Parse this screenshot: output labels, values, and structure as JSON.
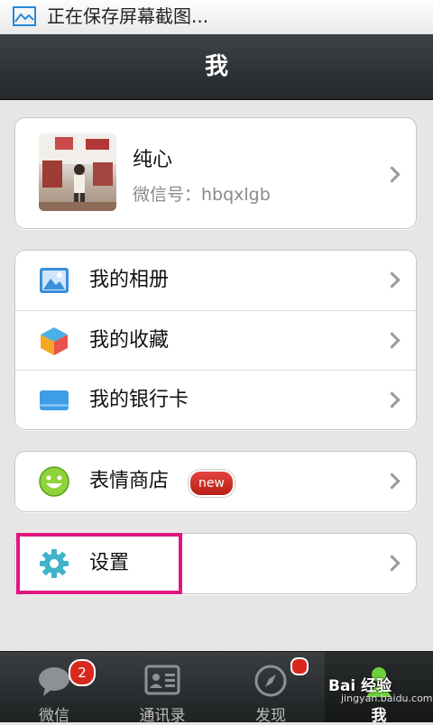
{
  "status_bar": {
    "text": "正在保存屏幕截图...",
    "icon": "screenshot-icon"
  },
  "header": {
    "title": "我"
  },
  "profile": {
    "name": "纯心",
    "wechat_id": "微信号：hbqxlgb"
  },
  "menu_group_1": [
    {
      "label": "我的相册",
      "icon": "album-icon"
    },
    {
      "label": "我的收藏",
      "icon": "favorites-icon"
    },
    {
      "label": "我的银行卡",
      "icon": "bank-card-icon"
    }
  ],
  "sticker_store": {
    "label": "表情商店",
    "badge": "new"
  },
  "settings": {
    "label": "设置",
    "icon": "gear-icon"
  },
  "tabbar": {
    "tabs": [
      {
        "label": "微信",
        "badge": "2"
      },
      {
        "label": "通讯录"
      },
      {
        "label": "发现"
      },
      {
        "label": "我"
      }
    ]
  },
  "watermark": {
    "text": "Bai 经验",
    "sub": "jingyan.baidu.com"
  },
  "colors": {
    "highlight": "#e0157f",
    "badge": "#d8281e"
  }
}
